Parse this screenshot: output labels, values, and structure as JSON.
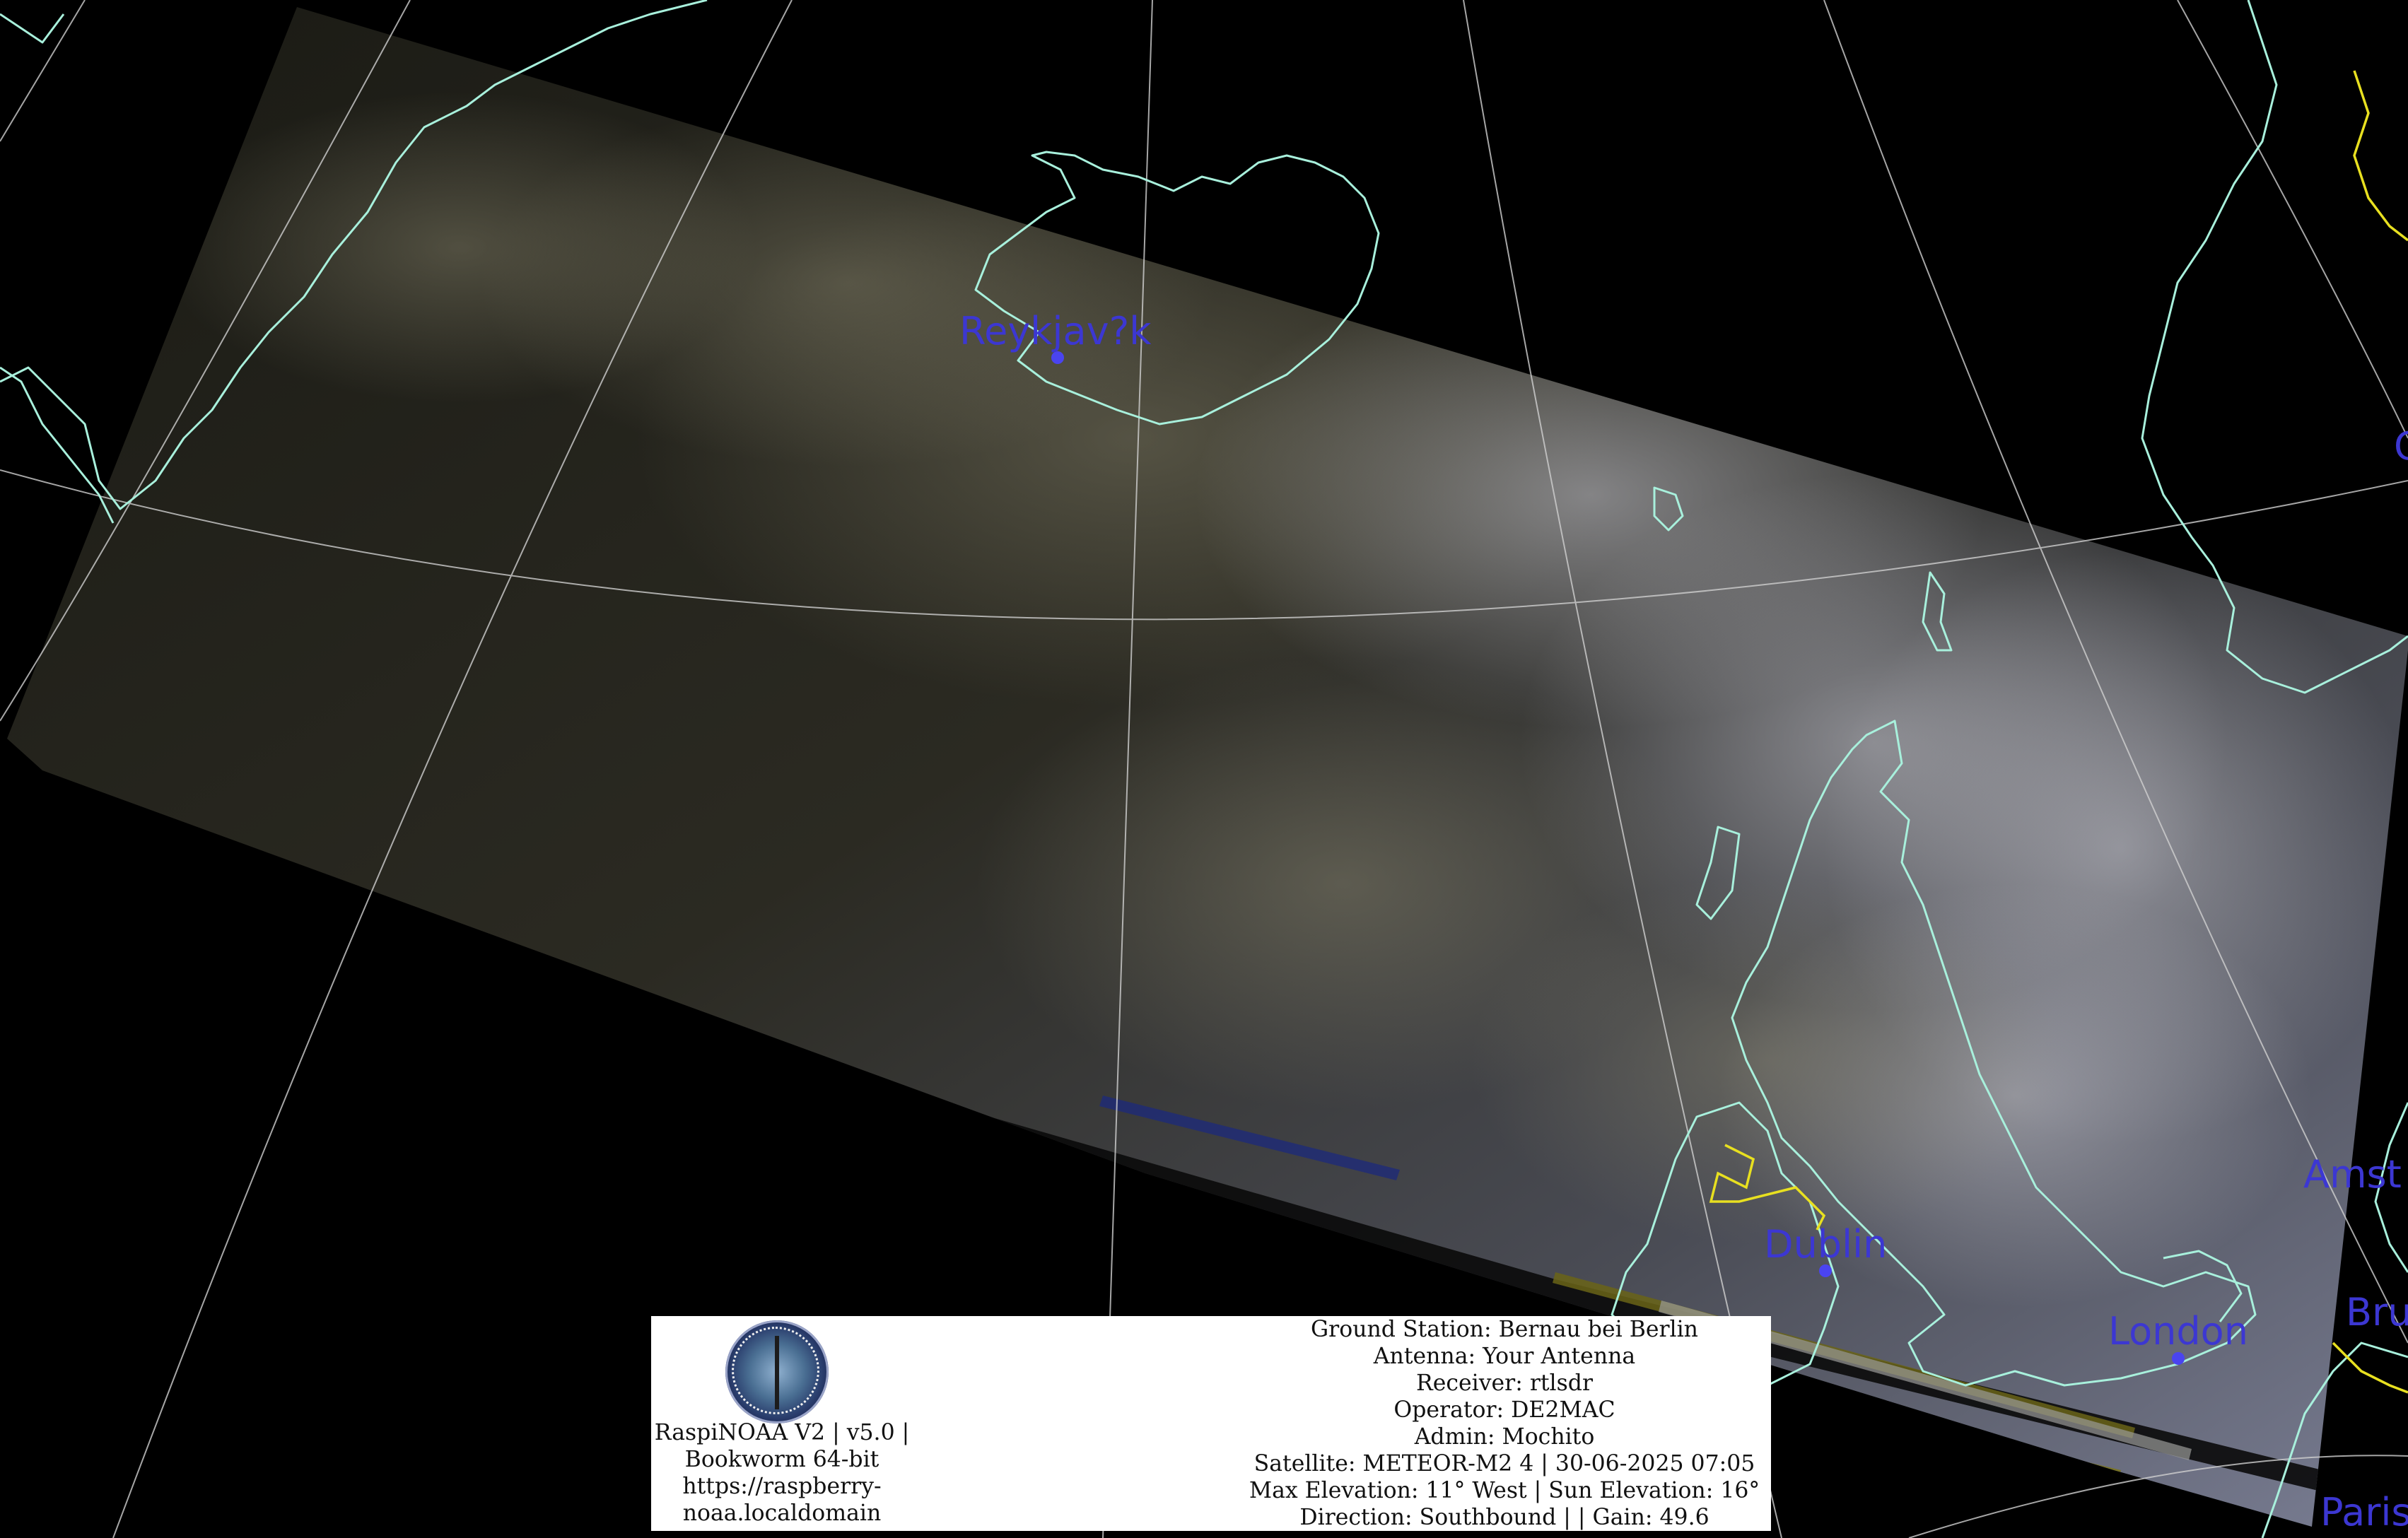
{
  "map": {
    "cities": [
      {
        "name": "Reykjav?k"
      },
      {
        "name": "Dublin"
      },
      {
        "name": "London"
      },
      {
        "name": "Amst"
      },
      {
        "name": "Bru"
      },
      {
        "name": "Paris"
      },
      {
        "name": "O"
      }
    ],
    "colors": {
      "background": "#000000",
      "coastline": "#a8f0dc",
      "graticule": "#cfcfcf",
      "city_label": "#3c37d2",
      "border": "#e8e020",
      "panel": "#ffffff"
    }
  },
  "station": {
    "logo_icon": "raspinoaa-logo",
    "lines": [
      "RaspiNOAA V2 | v5.0 |",
      "Bookworm 64-bit",
      "https://raspberry-",
      "noaa.localdomain"
    ]
  },
  "pass": {
    "lines": [
      "Ground Station: Bernau bei Berlin",
      "Antenna: Your Antenna",
      "Receiver: rtlsdr",
      "Operator: DE2MAC",
      "Admin: Mochito",
      "Satellite: METEOR-M2 4 | 30-06-2025 07:05",
      "Max Elevation: 11° West | Sun Elevation: 16°",
      "Direction: Southbound | | Gain: 49.6"
    ]
  }
}
